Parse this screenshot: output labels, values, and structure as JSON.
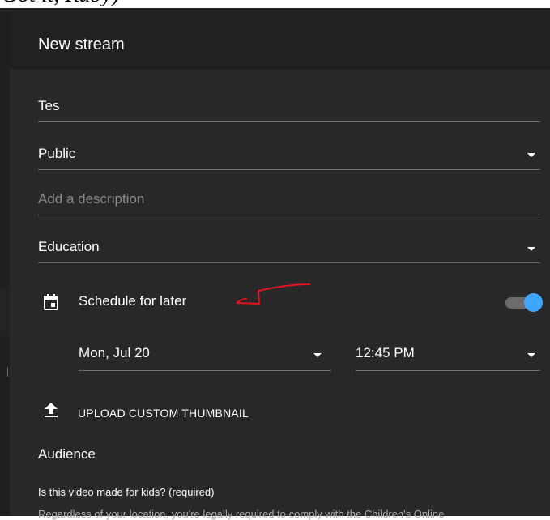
{
  "top_fragment": "Got it, Ruby)",
  "dialog": {
    "title": "New stream",
    "title_field": {
      "value": "Tes"
    },
    "visibility_select": {
      "value": "Public"
    },
    "description_field": {
      "placeholder": "Add a description"
    },
    "category_select": {
      "value": "Education"
    },
    "schedule": {
      "label": "Schedule for later",
      "enabled": true,
      "date": "Mon, Jul 20",
      "time": "12:45 PM"
    },
    "thumbnail_button": {
      "label": "UPLOAD CUSTOM THUMBNAIL"
    },
    "audience": {
      "heading": "Audience",
      "question": "Is this video made for kids? (required)",
      "legal_text": "Regardless of your location, you're legally required to comply with the Children's Online"
    }
  },
  "colors": {
    "dialog_bg": "#282828",
    "header_bg": "#212121",
    "accent": "#3ea6ff",
    "annotation": "#e0141e"
  },
  "icons": {
    "schedule": "calendar-icon",
    "dropdown": "caret-down-icon",
    "upload": "upload-icon"
  }
}
